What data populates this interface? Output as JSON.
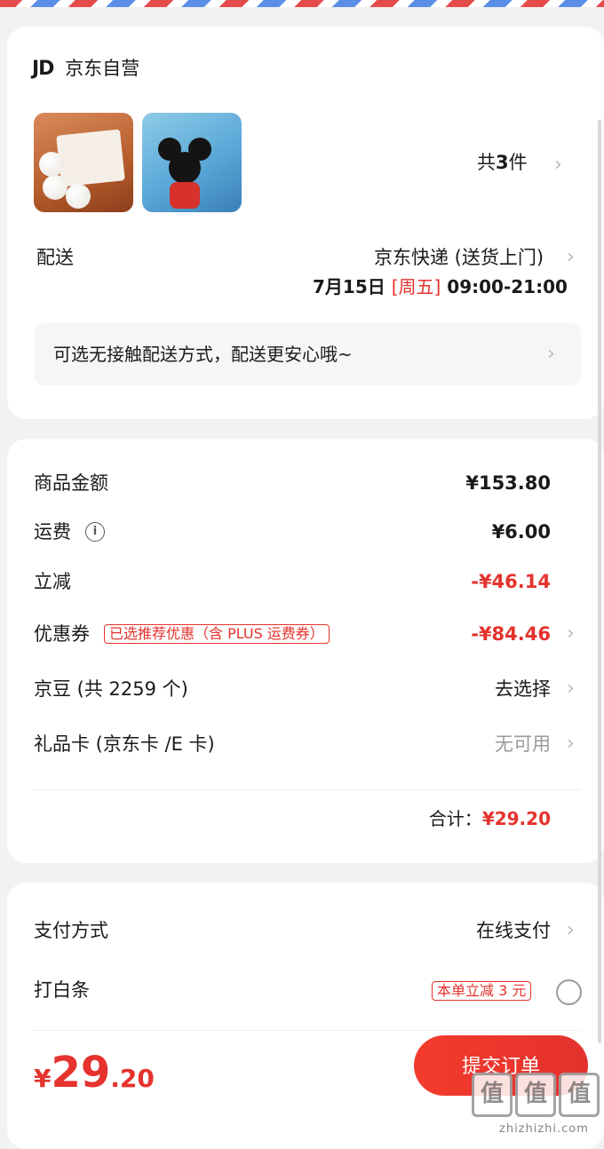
{
  "store": {
    "logo_text": "JD",
    "name": "京东自营"
  },
  "items": {
    "thumbnails": [
      "cotton-tissue-product",
      "mickey-blanket-product"
    ],
    "count_prefix": "共",
    "count": "3",
    "count_suffix": "件"
  },
  "delivery": {
    "label": "配送",
    "method": "京东快递 (送货上门)",
    "date": "7月15日",
    "weekday": "[周五]",
    "time_window": "09:00-21:00",
    "contactless_tip": "可选无接触配送方式，配送更安心哦~"
  },
  "pricing": {
    "goods_amount_label": "商品金额",
    "goods_amount": "¥153.80",
    "shipping_label": "运费",
    "shipping_fee": "¥6.00",
    "instant_discount_label": "立减",
    "instant_discount": "-¥46.14",
    "coupon_label": "优惠券",
    "coupon_tag": "已选推荐优惠（含 PLUS 运费券）",
    "coupon_discount": "-¥84.46",
    "jingdou_label": "京豆 (共 2259 个)",
    "jingdou_action": "去选择",
    "giftcard_label": "礼品卡 (京东卡 /E 卡)",
    "giftcard_status": "无可用",
    "total_label": "合计：",
    "total_value": "¥29.20"
  },
  "payment": {
    "method_label": "支付方式",
    "method_value": "在线支付",
    "baitiao_label": "打白条",
    "baitiao_tag": "本单立减 3 元"
  },
  "footer": {
    "currency": "¥",
    "price_int": "29",
    "price_dec": ".20",
    "submit_label": "提交订单"
  },
  "watermark": {
    "chars": [
      "值",
      "值",
      "值"
    ],
    "url": "zhizhizhi.com"
  },
  "colors": {
    "accent_red": "#e5322d",
    "muted_gray": "#9a9a9a"
  },
  "icons": [
    "chevron-right-icon",
    "info-icon",
    "radio-unchecked-icon"
  ]
}
